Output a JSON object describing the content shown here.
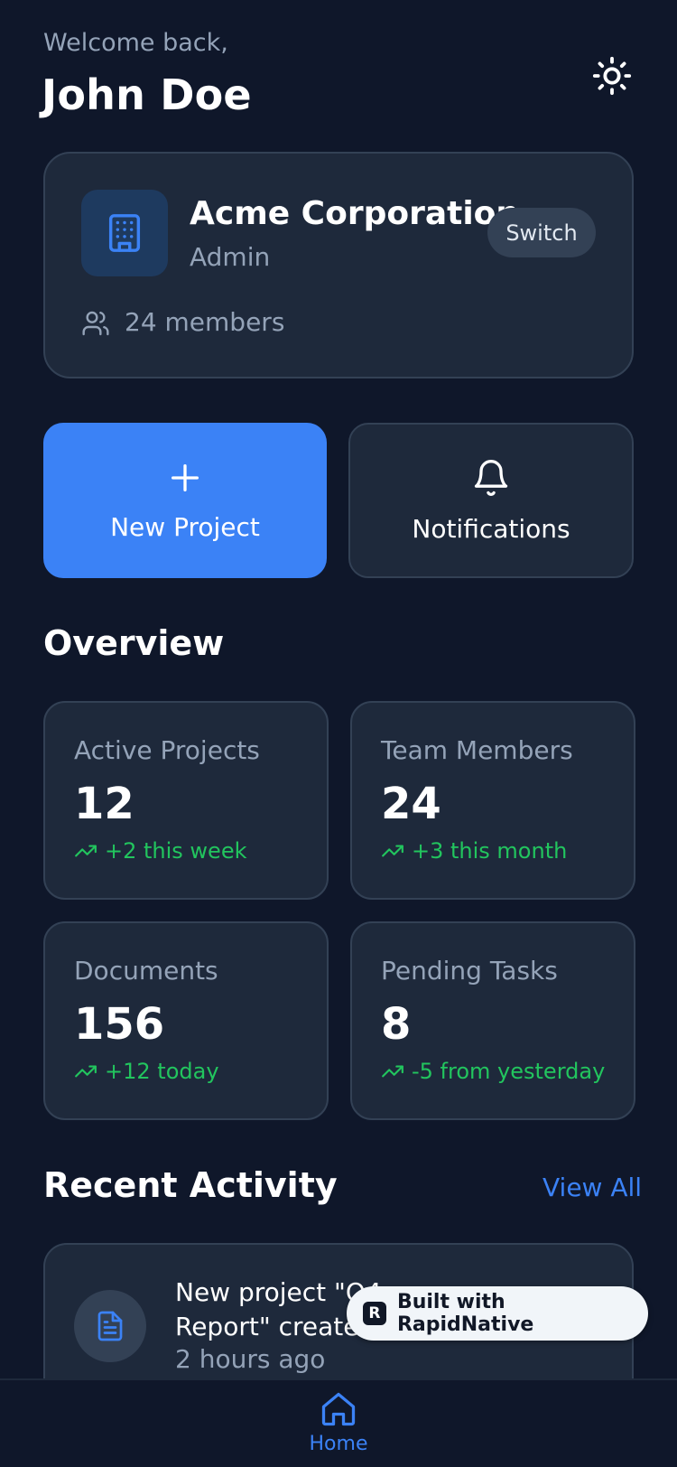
{
  "header": {
    "welcome": "Welcome back,",
    "username": "John Doe",
    "theme_icon": "sun-icon"
  },
  "organization": {
    "name": "Acme Corporation",
    "role": "Admin",
    "switch_label": "Switch",
    "members": "24 members",
    "icon": "building-icon"
  },
  "actions": {
    "new_project": "New Project",
    "notifications": "Notifications"
  },
  "overview": {
    "title": "Overview",
    "stats": [
      {
        "label": "Active Projects",
        "value": "12",
        "trend": "+2 this week"
      },
      {
        "label": "Team Members",
        "value": "24",
        "trend": "+3 this month"
      },
      {
        "label": "Documents",
        "value": "156",
        "trend": "+12 today"
      },
      {
        "label": "Pending Tasks",
        "value": "8",
        "trend": "-5 from yesterday"
      }
    ]
  },
  "recent": {
    "title": "Recent Activity",
    "view_all": "View All",
    "items": [
      {
        "text": "New project \"Q4 Report\" created",
        "time": "2 hours ago",
        "icon": "file-text-icon"
      }
    ]
  },
  "badge": {
    "label": "Built with RapidNative",
    "logo_letter": "R"
  },
  "nav": {
    "home": "Home"
  },
  "colors": {
    "background": "#0f172a",
    "card": "#1e293b",
    "accent": "#3b82f6",
    "positive": "#22c55e",
    "muted": "#94a3b8"
  }
}
